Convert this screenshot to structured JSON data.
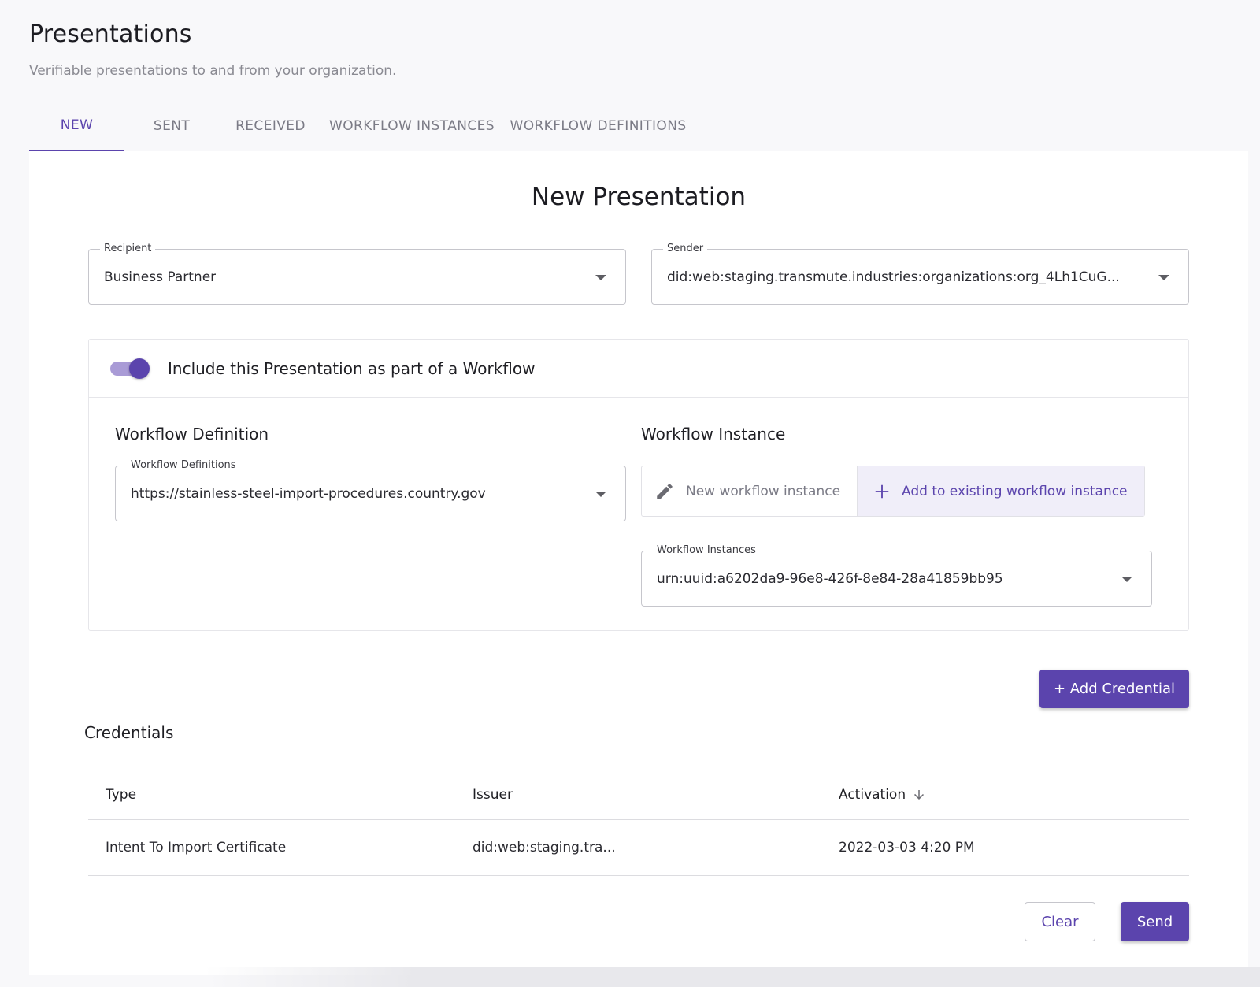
{
  "header": {
    "title": "Presentations",
    "subtitle": "Verifiable presentations to and from your organization."
  },
  "tabs": [
    {
      "label": "NEW",
      "active": true
    },
    {
      "label": "SENT",
      "active": false
    },
    {
      "label": "RECEIVED",
      "active": false
    },
    {
      "label": "WORKFLOW INSTANCES",
      "active": false
    },
    {
      "label": "WORKFLOW DEFINITIONS",
      "active": false
    }
  ],
  "form": {
    "title": "New Presentation",
    "recipient": {
      "label": "Recipient",
      "value": "Business Partner"
    },
    "sender": {
      "label": "Sender",
      "value": "did:web:staging.transmute.industries:organizations:org_4Lh1CuG..."
    },
    "workflow_toggle": {
      "label": "Include this Presentation as part of a Workflow",
      "on": true
    },
    "workflow_definition": {
      "title": "Workflow Definition",
      "field_label": "Workflow Definitions",
      "value": "https://stainless-steel-import-procedures.country.gov"
    },
    "workflow_instance": {
      "title": "Workflow Instance",
      "new_label": "New workflow instance",
      "add_label": "Add to existing workflow instance",
      "field_label": "Workflow Instances",
      "value": "urn:uuid:a6202da9-96e8-426f-8e84-28a41859bb95"
    },
    "add_credential_label": "+ Add Credential"
  },
  "credentials": {
    "title": "Credentials",
    "columns": [
      "Type",
      "Issuer",
      "Activation"
    ],
    "rows": [
      {
        "type": "Intent To Import Certificate",
        "issuer": "did:web:staging.tra...",
        "activation": "2022-03-03 4:20 PM"
      }
    ]
  },
  "actions": {
    "clear_label": "Clear",
    "send_label": "Send"
  },
  "colors": {
    "accent": "#5b44ad",
    "accent_light": "#f0eef9",
    "toggle_track": "#a99bd6"
  }
}
